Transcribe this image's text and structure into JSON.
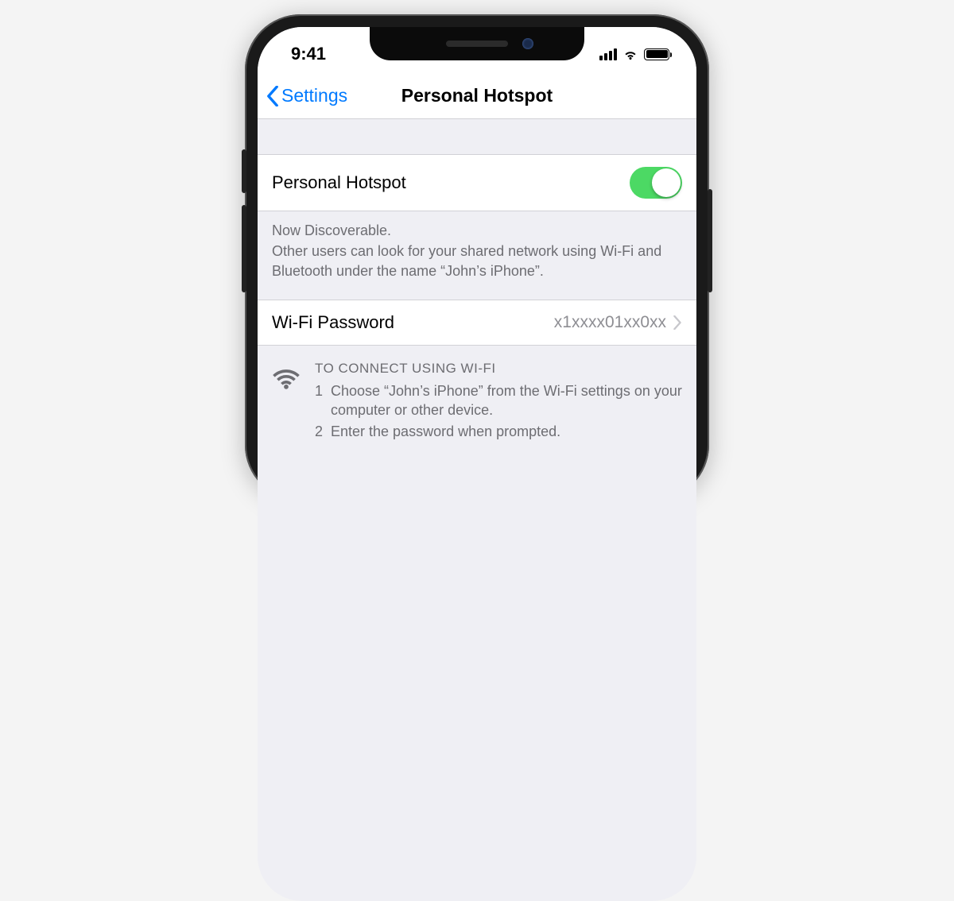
{
  "status": {
    "time": "9:41"
  },
  "nav": {
    "back": "Settings",
    "title": "Personal Hotspot"
  },
  "hotspot": {
    "label": "Personal Hotspot",
    "enabled": true,
    "footnote_head": "Now Discoverable.",
    "footnote_body": "Other users can look for your shared network using Wi-Fi and Bluetooth under the name “John’s iPhone”."
  },
  "password": {
    "label": "Wi-Fi Password",
    "value": "x1xxxx01xx0xx"
  },
  "instructions": {
    "title": "TO CONNECT USING WI-FI",
    "step1_num": "1",
    "step1_text": "Choose “John’s iPhone” from the Wi-Fi settings on your computer or other device.",
    "step2_num": "2",
    "step2_text": "Enter the password when prompted."
  }
}
